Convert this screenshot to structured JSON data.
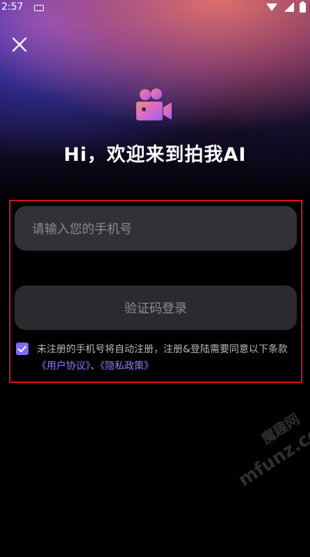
{
  "status": {
    "time": "2:57"
  },
  "header": {
    "welcome": "Hi，欢迎来到拍我AI"
  },
  "form": {
    "phone_placeholder": "请输入您的手机号",
    "login_button": "验证码登录",
    "checkbox_checked": true,
    "agree_text": "未注册的手机号将自动注册，注册&登陆需要同意以下条款",
    "user_agreement": "《用户协议》",
    "separator": "、",
    "privacy_policy": "《隐私政策》"
  },
  "watermark": {
    "cn": "魔趣网",
    "en": "mfunz.com"
  },
  "colors": {
    "accent": "#7b6bf5",
    "highlight_box": "#e00d1a",
    "input_bg": "#323236"
  },
  "icons": {
    "close": "close-icon",
    "logo": "video-camera-icon",
    "check": "check-icon"
  }
}
